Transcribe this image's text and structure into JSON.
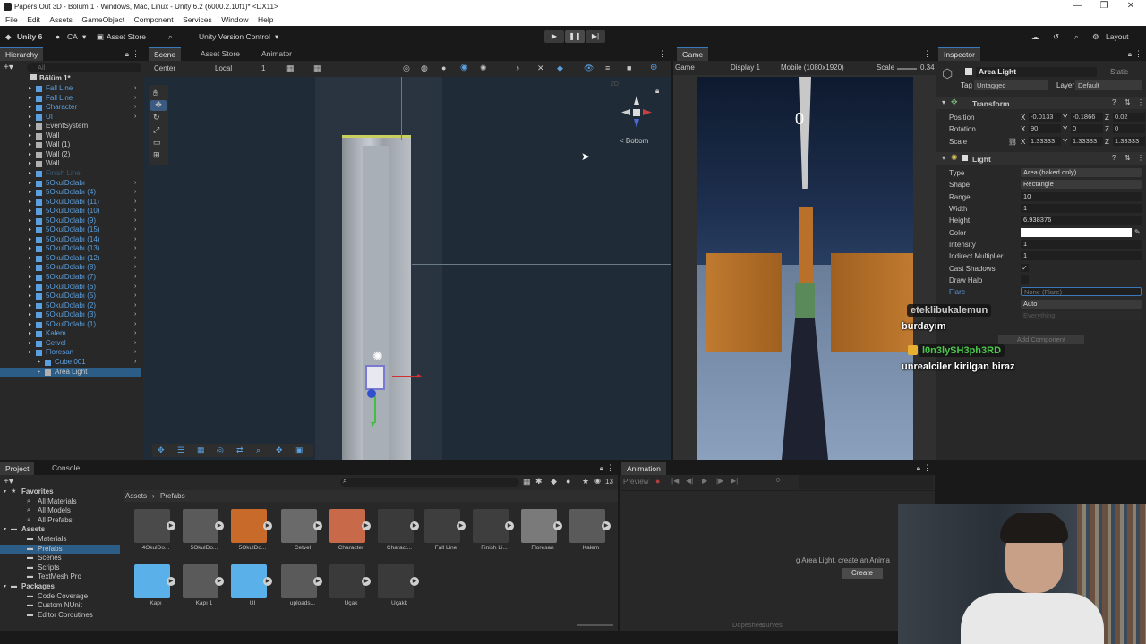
{
  "window": {
    "title": "Papers Out 3D - Bölüm 1 - Windows, Mac, Linux - Unity 6.2 (6000.2.10f1)* <DX11>",
    "min": "—",
    "max": "❐",
    "close": "✕"
  },
  "menu": [
    "File",
    "Edit",
    "Assets",
    "GameObject",
    "Component",
    "Services",
    "Window",
    "Help"
  ],
  "toolbar": {
    "unity": "Unity 6",
    "account": "CA",
    "asset_store": "Asset Store",
    "version_control": "Unity Version Control",
    "layout": "Layout"
  },
  "hierarchy": {
    "tab": "Hierarchy",
    "search_placeholder": "All",
    "scene": "Bölüm 1*",
    "items": [
      {
        "label": "Fall Line",
        "indent": 1,
        "color": "#5aa0e0"
      },
      {
        "label": "Fall Line",
        "indent": 1,
        "color": "#5aa0e0"
      },
      {
        "label": "Character",
        "indent": 1,
        "color": "#5aa0e0"
      },
      {
        "label": "UI",
        "indent": 1,
        "color": "#5aa0e0"
      },
      {
        "label": "EventSystem",
        "indent": 1,
        "color": "#c8c8c8"
      },
      {
        "label": "Wall",
        "indent": 1,
        "color": "#c8c8c8"
      },
      {
        "label": "Wall (1)",
        "indent": 1,
        "color": "#c8c8c8"
      },
      {
        "label": "Wall (2)",
        "indent": 1,
        "color": "#c8c8c8"
      },
      {
        "label": "Wall",
        "indent": 1,
        "color": "#c8c8c8"
      },
      {
        "label": "Finish Line",
        "indent": 1,
        "color": "#3a5a78"
      },
      {
        "label": "5OkulDolabı",
        "indent": 1,
        "color": "#5aa0e0"
      },
      {
        "label": "5OkulDolabı (4)",
        "indent": 1,
        "color": "#5aa0e0"
      },
      {
        "label": "5OkulDolabı (11)",
        "indent": 1,
        "color": "#5aa0e0"
      },
      {
        "label": "5OkulDolabı (10)",
        "indent": 1,
        "color": "#5aa0e0"
      },
      {
        "label": "5OkulDolabı (9)",
        "indent": 1,
        "color": "#5aa0e0"
      },
      {
        "label": "5OkulDolabı (15)",
        "indent": 1,
        "color": "#5aa0e0"
      },
      {
        "label": "5OkulDolabı (14)",
        "indent": 1,
        "color": "#5aa0e0"
      },
      {
        "label": "5OkulDolabı (13)",
        "indent": 1,
        "color": "#5aa0e0"
      },
      {
        "label": "5OkulDolabı (12)",
        "indent": 1,
        "color": "#5aa0e0"
      },
      {
        "label": "5OkulDolabı (8)",
        "indent": 1,
        "color": "#5aa0e0"
      },
      {
        "label": "5OkulDolabı (7)",
        "indent": 1,
        "color": "#5aa0e0"
      },
      {
        "label": "5OkulDolabı (6)",
        "indent": 1,
        "color": "#5aa0e0"
      },
      {
        "label": "5OkulDolabı (5)",
        "indent": 1,
        "color": "#5aa0e0"
      },
      {
        "label": "5OkulDolabı (2)",
        "indent": 1,
        "color": "#5aa0e0"
      },
      {
        "label": "5OkulDolabı (3)",
        "indent": 1,
        "color": "#5aa0e0"
      },
      {
        "label": "5OkulDolabı (1)",
        "indent": 1,
        "color": "#5aa0e0"
      },
      {
        "label": "Kalem",
        "indent": 1,
        "color": "#5aa0e0"
      },
      {
        "label": "Cetvel",
        "indent": 1,
        "color": "#5aa0e0"
      },
      {
        "label": "Floresan",
        "indent": 1,
        "color": "#5aa0e0"
      },
      {
        "label": "Cube.001",
        "indent": 2,
        "color": "#5aa0e0"
      },
      {
        "label": "Area Light",
        "indent": 2,
        "color": "#c8c8c8",
        "selected": true
      }
    ]
  },
  "scene_view": {
    "tabs": [
      "Scene",
      "Asset Store",
      "Animator"
    ],
    "pivot": "Center",
    "space": "Local",
    "grid_num": "1",
    "gizmo_label": "< Bottom",
    "two_d": "2D"
  },
  "game_view": {
    "tab": "Game",
    "mode": "Game",
    "display": "Display 1",
    "resolution": "Mobile (1080x1920)",
    "scale_label": "Scale",
    "scale_value": "0.34",
    "score": "0"
  },
  "inspector": {
    "tab": "Inspector",
    "object_name": "Area Light",
    "static": "Static",
    "tag_label": "Tag",
    "tag_value": "Untagged",
    "layer_label": "Layer",
    "layer_value": "Default",
    "transform": {
      "title": "Transform",
      "position_label": "Position",
      "pos_x": "-0.0133",
      "pos_y": "-0.1866",
      "pos_z": "0.02",
      "rotation_label": "Rotation",
      "rot_x": "90",
      "rot_y": "0",
      "rot_z": "0",
      "scale_label": "Scale",
      "scl_x": "1.33333",
      "scl_y": "1.33333",
      "scl_z": "1.33333"
    },
    "light": {
      "title": "Light",
      "type_label": "Type",
      "type_value": "Area (baked only)",
      "shape_label": "Shape",
      "shape_value": "Rectangle",
      "range_label": "Range",
      "range_value": "10",
      "width_label": "Width",
      "width_value": "1",
      "height_label": "Height",
      "height_value": "6.938376",
      "color_label": "Color",
      "intensity_label": "Intensity",
      "intensity_value": "1",
      "indirect_label": "Indirect Multiplier",
      "indirect_value": "1",
      "shadows_label": "Cast Shadows",
      "halo_label": "Draw Halo",
      "flare_label": "Flare",
      "flare_value": "None (Flare)",
      "render_value": "Auto",
      "culling_value": "Everything",
      "add_component": "Add Component"
    }
  },
  "project": {
    "tabs": [
      "Project",
      "Console"
    ],
    "breadcrumb_root": "Assets",
    "breadcrumb_child": "Prefabs",
    "count": "13",
    "tree": [
      {
        "label": "Favorites",
        "bold": true,
        "indent": 0
      },
      {
        "label": "All Materials",
        "indent": 1
      },
      {
        "label": "All Models",
        "indent": 1
      },
      {
        "label": "All Prefabs",
        "indent": 1
      },
      {
        "label": "Assets",
        "bold": true,
        "indent": 0
      },
      {
        "label": "Materials",
        "indent": 1
      },
      {
        "label": "Prefabs",
        "indent": 1,
        "selected": true
      },
      {
        "label": "Scenes",
        "indent": 1
      },
      {
        "label": "Scripts",
        "indent": 1
      },
      {
        "label": "TextMesh Pro",
        "indent": 1
      },
      {
        "label": "Packages",
        "bold": true,
        "indent": 0
      },
      {
        "label": "Code Coverage",
        "indent": 1
      },
      {
        "label": "Custom NUnit",
        "indent": 1
      },
      {
        "label": "Editor Coroutines",
        "indent": 1
      }
    ],
    "assets_row1": [
      "4OkulDo...",
      "5OkulDo...",
      "5OkulDo...",
      "Cetvel",
      "Character",
      "Charact...",
      "Fall Line",
      "Finish Li...",
      "Floresan",
      "Kalem"
    ],
    "assets_row2": [
      "Kapı",
      "Kapı 1",
      "UI",
      "uploads...",
      "Uçak",
      "Uçakk"
    ],
    "asset_colors_row1": [
      "#4a4a4a",
      "#5a5a5a",
      "#c86a2a",
      "#6a6a6a",
      "#c86a4a",
      "#3a3a3a",
      "#3e3e3e",
      "#3e3e3e",
      "#7a7a7a",
      "#5a5a5a"
    ],
    "asset_colors_row2": [
      "#5ab0e8",
      "#5a5a5a",
      "#5ab0e8",
      "#5a5a5a",
      "#3a3a3a",
      "#3a3a3a"
    ]
  },
  "animation": {
    "tab": "Animation",
    "preview": "Preview",
    "frame": "0",
    "hint": "g Area Light, create an Anima",
    "create": "Create",
    "dopesheet": "Dopesheet",
    "curves": "Curves"
  },
  "chat": [
    {
      "user": "eteklibukalemun",
      "user_color": "#ffffff",
      "message": "burdayım"
    },
    {
      "user": "l0n3lySH3ph3RD",
      "user_color": "#4ac94a",
      "message": "unrealciler kirilgan biraz"
    }
  ]
}
